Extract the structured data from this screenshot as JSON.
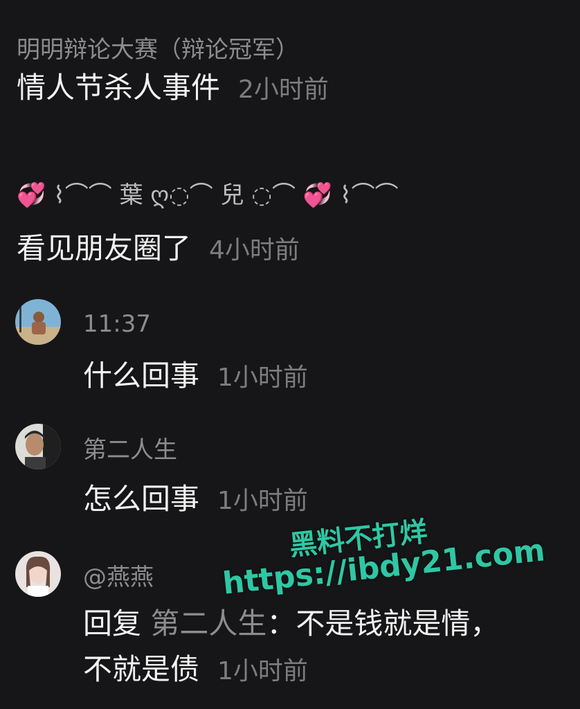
{
  "comments": [
    {
      "username": "明明辩论大赛（辩论冠军）",
      "text": "情人节杀人事件",
      "time": "2小时前"
    },
    {
      "username_parts": [
        "葉",
        "兒"
      ],
      "text": "看见朋友圈了",
      "time": "4小时前"
    }
  ],
  "replies": [
    {
      "username": "11:37",
      "text": "什么回事",
      "time": "1小时前",
      "avatar": "avatar-beach-man"
    },
    {
      "username": "第二人生",
      "text": "怎么回事",
      "time": "1小时前",
      "avatar": "avatar-man-portrait"
    },
    {
      "username": "@燕燕",
      "reply_prefix": "回复",
      "reply_to": "第二人生",
      "text_line1": "：不是钱就是情，",
      "text_line2": "不就是债",
      "time": "1小时前",
      "avatar": "avatar-woman-portrait"
    }
  ],
  "watermark": {
    "line1": "黑料不打烊",
    "line2": "https://ibdy21.com",
    "color": "#2fc7a4"
  },
  "colors": {
    "background": "#161618",
    "text": "#f2f2f2",
    "muted": "#8c8c8e",
    "heart": "#ff4fa8"
  }
}
